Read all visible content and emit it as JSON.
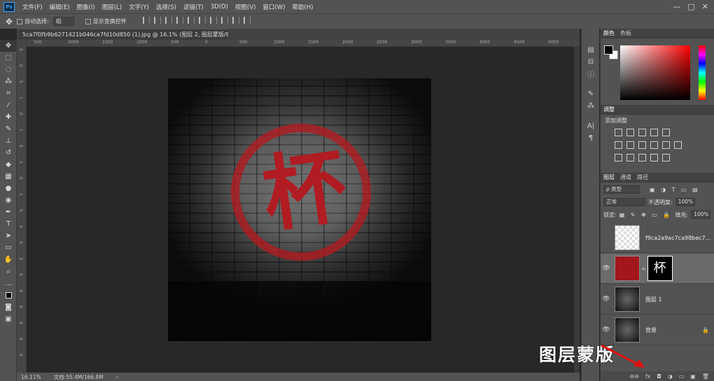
{
  "menubar": {
    "logo": "Ps",
    "items": [
      "文件(F)",
      "编辑(E)",
      "图像(I)",
      "图层(L)",
      "文字(Y)",
      "选择(S)",
      "滤镜(T)",
      "3D(D)",
      "视图(V)",
      "窗口(W)",
      "帮助(H)"
    ],
    "window_controls": [
      "—",
      "□",
      "✕"
    ]
  },
  "options_bar": {
    "auto_select_label": "自动选择:",
    "auto_select_value": "组",
    "show_transform_label": "显示变换控件"
  },
  "document_tab": {
    "title": "5ca7f0fb9b6271421b046ca7fd10d850 (1).jpg @ 16.1% (图层 2, 图层蒙版/8) *",
    "close": "✕"
  },
  "ruler_top_ticks": [
    "500",
    "2000",
    "1500",
    "1000",
    "500",
    "0",
    "500",
    "1000",
    "1500",
    "2000",
    "2500",
    "3000",
    "3500",
    "4000",
    "4500",
    "5000"
  ],
  "ruler_left_ticks": [
    "5",
    "0",
    "5",
    "1",
    "0",
    "1",
    "5",
    "2",
    "0",
    "2",
    "5",
    "3",
    "0",
    "3",
    "5",
    "4",
    "0",
    "4",
    "5",
    "0"
  ],
  "canvas": {
    "glyph": "杯"
  },
  "status_bar": {
    "zoom": "16.11%",
    "doc_size": "文档:55.4M/166.8M",
    "arrow": "›"
  },
  "panels": {
    "color": {
      "tabs": [
        "颜色",
        "色板"
      ],
      "foreground": "#000000",
      "background": "#ffffff"
    },
    "adjustments": {
      "tab": "调整",
      "title": "添加调整"
    },
    "layers": {
      "tabs": [
        "图层",
        "通道",
        "路径"
      ],
      "filter_kind": "ρ 类型",
      "blend_mode": "正常",
      "opacity_label": "不透明度:",
      "opacity_value": "100%",
      "lock_label": "锁定:",
      "fill_label": "填充:",
      "fill_value": "100%",
      "items": [
        {
          "name": "f9ca2a9ac7ca98bec7...",
          "visible": false,
          "selected": false
        },
        {
          "name": "",
          "visible": true,
          "selected": true
        },
        {
          "name": "图层 1",
          "visible": true,
          "selected": false
        },
        {
          "name": "背景",
          "visible": true,
          "selected": false
        }
      ],
      "footer_icons": [
        "⊖⊖",
        "fx",
        "◘",
        "◑",
        "▭",
        "▣",
        "🗑"
      ]
    }
  },
  "annotation": {
    "label": "图层蒙版",
    "color": "#e01010"
  }
}
